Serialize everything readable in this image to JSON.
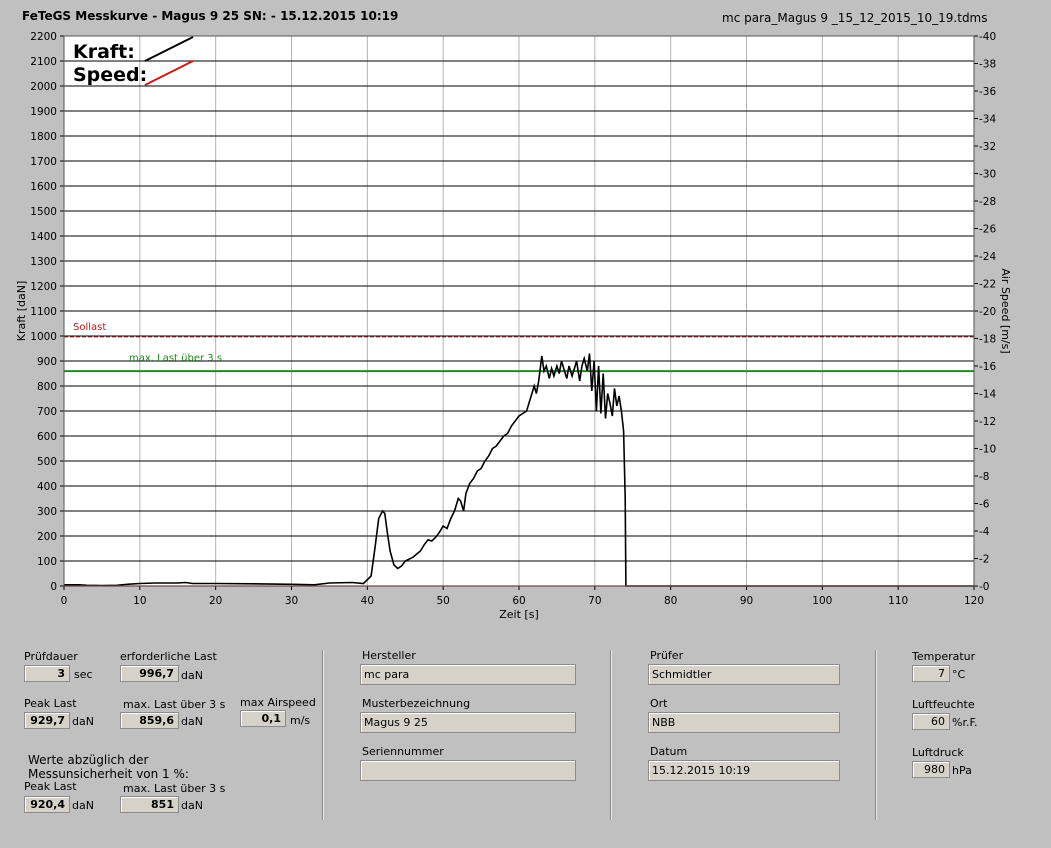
{
  "header": {
    "title": "FeTeGS Messkurve - Magus 9 25  SN:  - 15.12.2015 10:19",
    "filename": "mc para_Magus 9 _15_12_2015_10_19.tdms"
  },
  "chart_data": {
    "type": "line",
    "xlabel": "Zeit [s]",
    "ylabel": "Kraft [daN]",
    "y2label": "Air Speed [m/s]",
    "xlim": [
      0,
      120
    ],
    "ylim": [
      0,
      2200
    ],
    "y2lim": [
      0,
      40
    ],
    "xticks": [
      0,
      10,
      20,
      30,
      40,
      50,
      60,
      70,
      80,
      90,
      100,
      110,
      120
    ],
    "yticks": [
      0,
      100,
      200,
      300,
      400,
      500,
      600,
      700,
      800,
      900,
      1000,
      1100,
      1200,
      1300,
      1400,
      1500,
      1600,
      1700,
      1800,
      1900,
      2000,
      2100,
      2200
    ],
    "y2ticks": [
      0,
      2,
      4,
      6,
      8,
      10,
      12,
      14,
      16,
      18,
      20,
      22,
      24,
      26,
      28,
      30,
      32,
      34,
      36,
      38,
      40
    ],
    "grid": true,
    "legend": [
      {
        "label": "Kraft:",
        "color": "#000000"
      },
      {
        "label": "Speed:",
        "color": "#d01818"
      }
    ],
    "reference_lines": [
      {
        "label": "Sollast",
        "value": 996.7,
        "color": "#b81c1c"
      },
      {
        "label": "max. Last über  3 s",
        "value": 859.6,
        "color": "#1f8a1f"
      }
    ],
    "series": [
      {
        "name": "Kraft",
        "color": "#000000",
        "x": [
          0,
          2,
          3,
          5,
          7,
          8,
          10,
          12,
          15,
          16,
          17,
          20,
          25,
          30,
          33,
          35,
          38,
          39.5,
          40.5,
          41,
          41.5,
          42,
          42.3,
          42.6,
          43,
          43.5,
          44,
          44.5,
          45,
          46,
          47,
          47.5,
          48,
          48.5,
          49,
          49.5,
          50,
          50.5,
          51,
          51.5,
          52,
          52.3,
          52.7,
          53,
          53.5,
          54,
          54.5,
          55,
          55.5,
          56,
          56.5,
          57,
          57.5,
          58,
          58.5,
          59,
          59.5,
          60,
          60.5,
          61,
          61.5,
          62,
          62.3,
          62.6,
          63,
          63.3,
          63.6,
          64,
          64.3,
          64.6,
          65,
          65.3,
          65.6,
          66,
          66.3,
          66.6,
          67,
          67.3,
          67.6,
          68,
          68.3,
          68.6,
          69,
          69.3,
          69.6,
          69.9,
          70.2,
          70.5,
          70.8,
          71.1,
          71.4,
          71.7,
          72,
          72.3,
          72.6,
          72.9,
          73.2,
          73.5,
          73.8,
          74.0,
          74.1,
          74.2,
          75,
          80,
          90,
          100,
          110,
          120
        ],
        "values": [
          5,
          5,
          3,
          2,
          3,
          6,
          10,
          12,
          12,
          14,
          10,
          10,
          9,
          7,
          5,
          12,
          14,
          10,
          40,
          150,
          270,
          300,
          290,
          220,
          140,
          85,
          70,
          80,
          100,
          115,
          140,
          165,
          185,
          180,
          195,
          215,
          240,
          230,
          270,
          300,
          350,
          340,
          300,
          370,
          410,
          430,
          460,
          470,
          500,
          520,
          550,
          560,
          580,
          600,
          610,
          640,
          660,
          680,
          690,
          700,
          750,
          800,
          770,
          820,
          920,
          860,
          880,
          830,
          870,
          840,
          880,
          850,
          900,
          860,
          830,
          880,
          840,
          870,
          900,
          820,
          880,
          910,
          860,
          930,
          780,
          900,
          700,
          880,
          690,
          850,
          670,
          770,
          730,
          680,
          790,
          720,
          760,
          700,
          620,
          350,
          0,
          0,
          0,
          0,
          0,
          0,
          0,
          0
        ]
      },
      {
        "name": "Speed",
        "color": "#d01818",
        "x": [
          0,
          120
        ],
        "values": [
          0,
          0
        ]
      }
    ]
  },
  "panel": {
    "pruefdauer": {
      "label": "Prüfdauer",
      "value": "3",
      "unit": "sec"
    },
    "erforderliche_last": {
      "label": "erforderliche Last",
      "value": "996,7",
      "unit": "daN"
    },
    "peak_last": {
      "label": "Peak Last",
      "value": "929,7",
      "unit": "daN"
    },
    "max_last": {
      "label": "max. Last über  3 s",
      "value": "859,6",
      "unit": "daN"
    },
    "max_airspeed": {
      "label": "max Airspeed",
      "value": "0,1",
      "unit": "m/s"
    },
    "werte_text_1": "Werte abzüglich der",
    "werte_text_2": "Messunsicherheit von 1   %:",
    "peak_last_corr": {
      "label": "Peak Last",
      "value": "920,4",
      "unit": "daN"
    },
    "max_last_corr": {
      "label": "max. Last über  3 s",
      "value": "851",
      "unit": "daN"
    },
    "hersteller": {
      "label": "Hersteller",
      "value": "mc para"
    },
    "musterbezeichnung": {
      "label": "Musterbezeichnung",
      "value": "Magus 9 25"
    },
    "seriennummer": {
      "label": "Seriennummer",
      "value": ""
    },
    "pruefer": {
      "label": "Prüfer",
      "value": "Schmidtler"
    },
    "ort": {
      "label": "Ort",
      "value": "NBB"
    },
    "datum": {
      "label": "Datum",
      "value": "15.12.2015 10:19"
    },
    "temperatur": {
      "label": "Temperatur",
      "value": "7",
      "unit": "°C"
    },
    "luftfeuchte": {
      "label": "Luftfeuchte",
      "value": "60",
      "unit": "%r.F."
    },
    "luftdruck": {
      "label": "Luftdruck",
      "value": "980",
      "unit": "hPa"
    }
  }
}
